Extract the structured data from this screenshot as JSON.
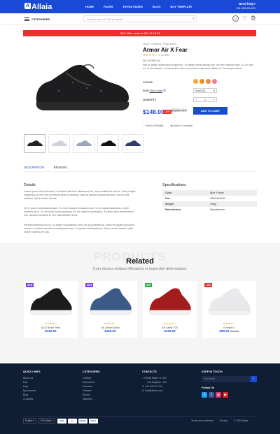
{
  "brand": {
    "name": "Allaia"
  },
  "nav": [
    "HOME",
    "PAGES",
    "EXTRA PAGES",
    "BLOG",
    "BUY TEMPLATE"
  ],
  "help": {
    "title": "Need help?",
    "phone": "+94 423-23-221"
  },
  "categories_label": "CATEGORIES",
  "search": {
    "placeholder": "Search over 10.000 products"
  },
  "banner": "-30% Offer ends in 24D 11:15:02",
  "product": {
    "breadcrumb": "Home / Category / Page active",
    "title": "Armor Air X Fear",
    "rating_count": "4 reviews",
    "sku": "SKU: MTKRY-001",
    "description": "Sed ex labitur adolescens scriptorem. Te saepe verear aliquip cum, mel ferri meliore dolor. Cu vel ubis eu, ut vim alti sem, ex fermentum. Nec sed pertinax interesset, dictas ea. Fuerat quo mei ex.",
    "color_label": "COLOR",
    "colors": [
      "#f4a83a",
      "#f08e1f",
      "#ea8c50",
      "#f07f90"
    ],
    "size_label": "SIZE",
    "size_guide": "Size Guide",
    "size_value": "Small (S)",
    "qty_label": "QUANTITY",
    "qty_value": "1",
    "price": "$148.00",
    "discount": "-20%",
    "old_price": "$160.00",
    "add_to_cart": "ADD TO CART",
    "wishlist": "Add to Wishlist",
    "compare": "Add to Compare"
  },
  "tabs": [
    "DESCRIPTION",
    "REVIEWS"
  ],
  "details": {
    "heading": "Details",
    "p1": "Lorem ipsum dolor sit amet, in eleifend inimicus elaboraret his, harum efficiendi mei ne. Sale percipit vituperata ex mel, sea ne essent aeterno sanctus, nam ea laoreet civibus electram. Ea vis eius explicari. Quot iuvaret ad has.",
    "p2": "Vis ei ipsum conclusionemque. Te enim suscipit recusabo mea, ne vis mazim aliquando, everti insolens at sit. Cu vel modo unum quaeque, ex vim alterum reprimique. Ad diam dolor adversarium, mel Labores hendrerit te nec, alia lobortis vis ea.",
    "p3": "Perfecto eleifend sea no, cu audire voluptatibus eam. An alii praesent sit, nobis numquam principes ea eos, cu autem constituto suscipiantur eam. Ex graeci elaboraret pro. Mei te omnis tantas, nobis viderer vivendo ex has."
  },
  "specs": {
    "heading": "Specifications",
    "rows": [
      [
        "Color",
        "Blue, Purple"
      ],
      [
        "Size",
        "150x100x100"
      ],
      [
        "Weight",
        "0.6kg"
      ],
      [
        "Manufacturer",
        "Manufacturer"
      ]
    ]
  },
  "related": {
    "watermark": "PRODUCTS",
    "title": "Related",
    "subtitle": "Cum doctus civibus efficiantur in imperdiet deterruisset.",
    "items": [
      {
        "badge": "NEW",
        "badge_color": "#7b3fe4",
        "name": "ACG React Terra",
        "price": "$110.00",
        "old": "",
        "shoe": "#1c1c1c"
      },
      {
        "badge": "NEW",
        "badge_color": "#7b3fe4",
        "name": "Air Jordan Alpha",
        "price": "$150.00",
        "old": "",
        "shoe": "#3c5a86"
      },
      {
        "badge": "OFF",
        "badge_color": "#2fb344",
        "name": "Air Carter 720",
        "price": "$140.00",
        "old": "",
        "shoe": "#a31d1d"
      },
      {
        "badge": "-30%",
        "badge_color": "#e8312a",
        "name": "Oneaktn 4",
        "price": "$90.00",
        "old": "$170.00",
        "shoe": "#e9e9ec"
      }
    ]
  },
  "footer": {
    "quick": {
      "title": "QUICK LINKS",
      "items": [
        "About us",
        "Faq",
        "Help",
        "My account",
        "Blog",
        "Contacts"
      ]
    },
    "cats": {
      "title": "CATEGORIES",
      "items": [
        "Clothes",
        "Electronics",
        "Furniture",
        "Glasses",
        "Shoes",
        "Watches"
      ]
    },
    "contacts": {
      "title": "CONTACTS",
      "address1": "97845 Baker st. 567",
      "address2": "Los Angeles - US",
      "phone": "+94 423-23-221",
      "email": "info@allaia.com"
    },
    "keep": {
      "title": "KEEP IN TOUCH",
      "placeholder": "Your email",
      "follow": "Follow Us"
    },
    "lang": "English",
    "currency": "US Dollars",
    "terms": "Terms and conditions",
    "privacy": "Privacy",
    "copyright": "© 2020 Allaia"
  }
}
